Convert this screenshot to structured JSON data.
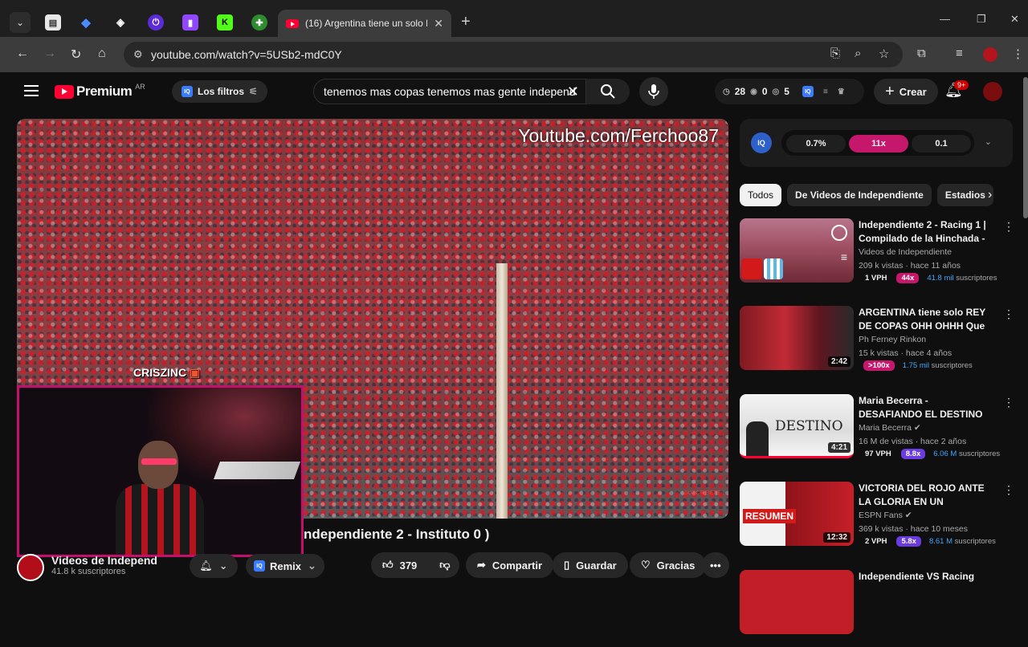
{
  "browser": {
    "tab_title": "(16) Argentina tiene un solo Re",
    "url": "youtube.com/watch?v=5USb2-mdC0Y"
  },
  "youtube": {
    "brand": "Premium",
    "region": "AR",
    "filters_label": "Los filtros",
    "search_query": "tenemos mas copas tenemos mas gente independ",
    "stats": {
      "a": "28",
      "b": "0",
      "c": "5"
    },
    "create_label": "Crear",
    "notif_badge": "9+"
  },
  "player": {
    "watermark": "Youtube.com/Ferchoo87",
    "subscribe_wm": "SUSCRIBETE",
    "cam_name": "CRISZINC",
    "title_partial": "ndependiente 2 - Instituto 0 )"
  },
  "channel": {
    "name": "Videos de Independ",
    "subscribers": "41.8 k suscriptores",
    "remix": "Remix"
  },
  "actions": {
    "likes": "379",
    "share": "Compartir",
    "save": "Guardar",
    "thanks": "Gracias"
  },
  "iq_panel": {
    "v1": "0.7%",
    "v2": "11x",
    "v3": "0.1"
  },
  "chips": [
    "Todos",
    "De Videos de Independiente",
    "Estadios"
  ],
  "recommendations": [
    {
      "title": "Independiente 2 - Racing 1 | Compilado de la Hinchada - ...",
      "channel": "Videos de Independiente",
      "meta": "209 k vistas · hace 11 años",
      "vph": "1 VPH",
      "mult": "44x",
      "subs_num": "41.8 mil",
      "subs_word": "suscriptores",
      "duration": ""
    },
    {
      "title": "ARGENTINA tiene solo REY DE COPAS OHH OHHH Que se ...",
      "channel": "Ph Ferney Rinkon",
      "meta": "15 k vistas · hace 4 años",
      "vph": "",
      "mult": ">100x",
      "subs_num": "1.75 mil",
      "subs_word": "suscriptores",
      "duration": "2:42"
    },
    {
      "title": "Maria Becerra - DESAFIANDO EL DESTINO (Live Session)",
      "channel": "Maria Becerra",
      "meta": "16 M de vistas · hace 2 años",
      "vph": "97 VPH",
      "mult": "8.8x",
      "subs_num": "6.06 M",
      "subs_word": "suscriptores",
      "duration": "4:21"
    },
    {
      "title": "VICTORIA DEL ROJO ANTE LA GLORIA EN UN ENCUENTRO ...",
      "channel": "ESPN Fans",
      "meta": "369 k vistas · hace 10 meses",
      "vph": "2 VPH",
      "mult": "5.8x",
      "subs_num": "8.61 M",
      "subs_word": "suscriptores",
      "duration": "12:32"
    },
    {
      "title": "Independiente VS Racing",
      "channel": "",
      "meta": "",
      "vph": "",
      "mult": "",
      "subs_num": "",
      "subs_word": "",
      "duration": ""
    }
  ],
  "thumb_texts": {
    "destino": "DESTINO",
    "resumen": "RESUMEN"
  },
  "colors": {
    "accent_pink": "#c5176c",
    "accent_purple": "#6a3ce0",
    "link_blue": "#3ea6ff",
    "yt_red": "#ff0033"
  }
}
